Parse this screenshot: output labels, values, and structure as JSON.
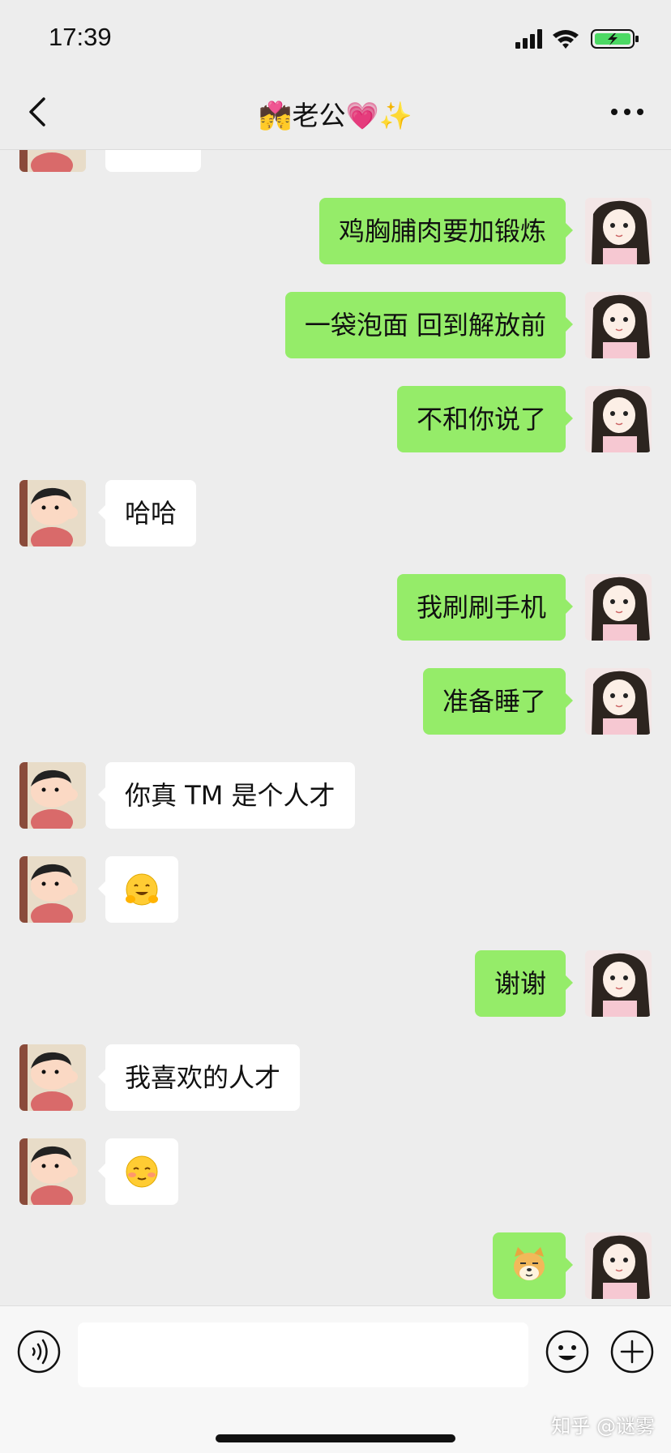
{
  "status_bar": {
    "time": "17:39"
  },
  "nav": {
    "title": "💏老公💗✨"
  },
  "messages": [
    {
      "side": "left",
      "text": ""
    },
    {
      "side": "right",
      "text": "鸡胸脯肉要加锻炼"
    },
    {
      "side": "right",
      "text": "一袋泡面 回到解放前"
    },
    {
      "side": "right",
      "text": "不和你说了"
    },
    {
      "side": "left",
      "text": "哈哈"
    },
    {
      "side": "right",
      "text": "我刷刷手机"
    },
    {
      "side": "right",
      "text": "准备睡了"
    },
    {
      "side": "left",
      "text": "你真 TM 是个人才"
    },
    {
      "side": "left",
      "emoji": "hug-emoji"
    },
    {
      "side": "right",
      "text": "谢谢"
    },
    {
      "side": "left",
      "text": "我喜欢的人才"
    },
    {
      "side": "left",
      "emoji": "blush-emoji"
    },
    {
      "side": "right",
      "emoji": "doge-emoji"
    }
  ],
  "input": {
    "value": ""
  },
  "watermark": "知乎 @谜雾",
  "colors": {
    "background": "#ededed",
    "sent_bubble": "#95ec69",
    "received_bubble": "#ffffff",
    "battery": "#4cd964"
  }
}
